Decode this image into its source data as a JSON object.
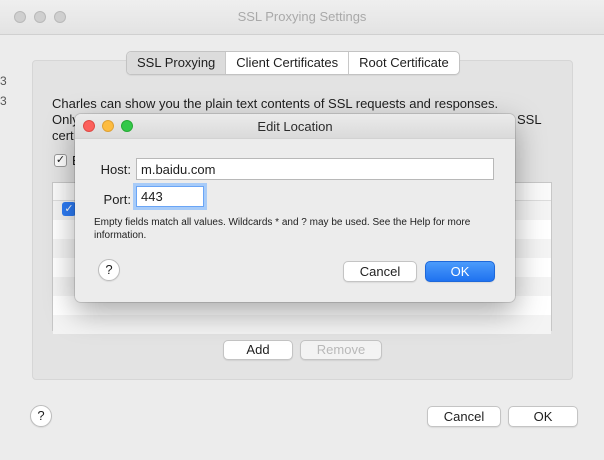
{
  "window": {
    "title": "SSL Proxying Settings",
    "left_fragments": [
      "3",
      "3"
    ]
  },
  "tabs": [
    {
      "label": "SSL Proxying",
      "active": true
    },
    {
      "label": "Client Certificates",
      "active": false
    },
    {
      "label": "Root Certificate",
      "active": false
    }
  ],
  "main": {
    "description_line1": "Charles can show you the plain text contents of SSL requests and responses.",
    "description_line2_prefix": "Only",
    "description_line2_suffix": "SSL",
    "description_line3_prefix": "cert",
    "enable_checkbox_fragment": "E",
    "add_label": "Add",
    "remove_label": "Remove"
  },
  "footer": {
    "help_label": "?",
    "cancel_label": "Cancel",
    "ok_label": "OK"
  },
  "dialog": {
    "title": "Edit Location",
    "host_label": "Host:",
    "host_value": "m.baidu.com",
    "port_label": "Port:",
    "port_value": "443",
    "hint": "Empty fields match all values. Wildcards * and ? may be used. See the Help for more information.",
    "help_label": "?",
    "cancel_label": "Cancel",
    "ok_label": "OK"
  },
  "colors": {
    "accent": "#1f72f0",
    "close": "#fc605c",
    "minimize": "#fdbc40",
    "zoom": "#34c84a"
  }
}
